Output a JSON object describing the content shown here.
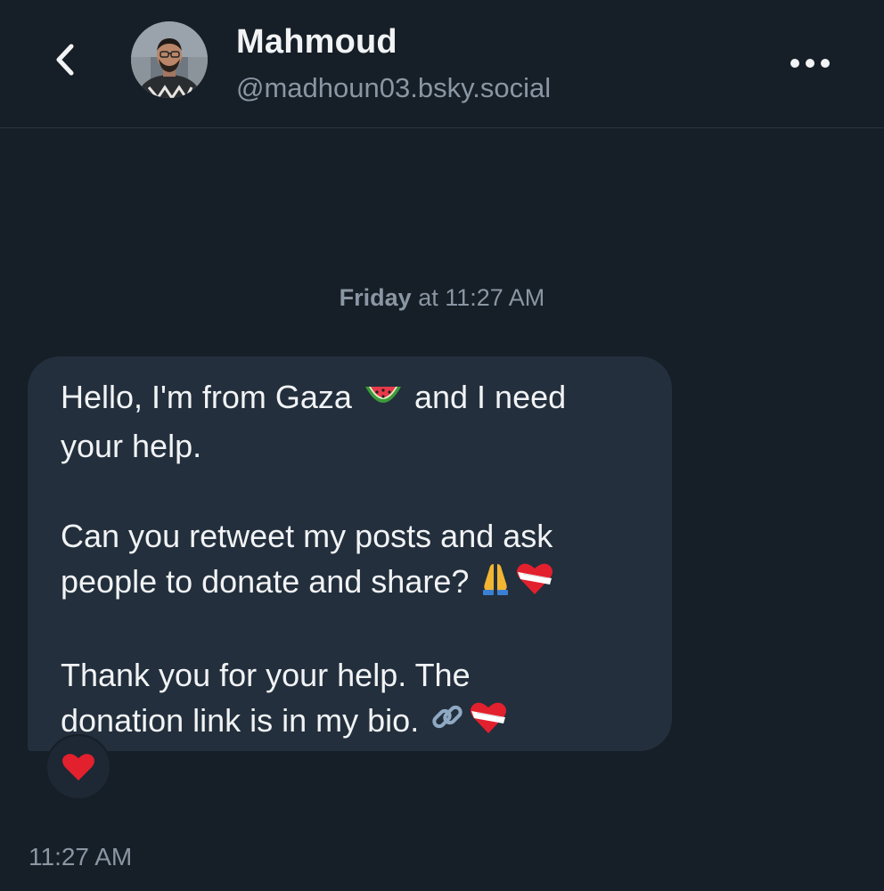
{
  "header": {
    "display_name": "Mahmoud",
    "handle": "@madhoun03.bsky.social",
    "back_icon": "chevron-left-icon",
    "more_icon": "more-horizontal-icon"
  },
  "conversation": {
    "date_separator": {
      "day": "Friday",
      "rest": " at 11:27 AM"
    },
    "message": {
      "paragraphs": [
        {
          "lines": [
            "Hello, I'm from Gaza ",
            " and I need",
            "your help."
          ]
        },
        {
          "lines": [
            "Can you retweet my posts and ask",
            "people to donate and share? "
          ]
        },
        {
          "lines": [
            "Thank you for your help. The",
            "donation link is in my bio. "
          ]
        }
      ],
      "reaction": "heart-icon",
      "timestamp": "11:27 AM"
    }
  },
  "colors": {
    "background": "#161e27",
    "bubble": "#232f3c",
    "text_primary": "#f1f3f5",
    "text_secondary": "#8a96a3",
    "heart": "#e3202e"
  }
}
